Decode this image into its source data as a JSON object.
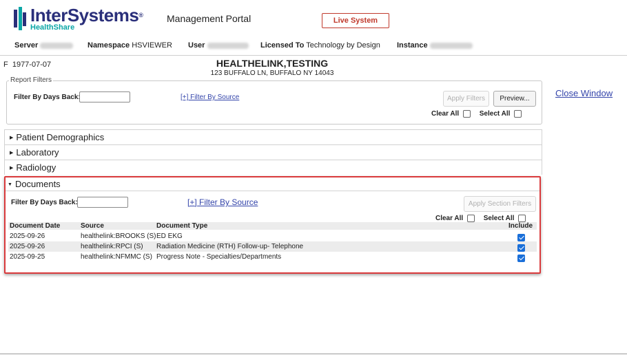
{
  "header": {
    "logo_text": "InterSystems",
    "logo_reg": "®",
    "logo_sub": "HealthShare",
    "portal_title": "Management Portal",
    "live_badge": "Live System"
  },
  "info_bar": {
    "server_label": "Server",
    "namespace_label": "Namespace",
    "namespace_value": "HSVIEWER",
    "user_label": "User",
    "licensed_label": "Licensed To",
    "licensed_value": "Technology by Design",
    "instance_label": "Instance"
  },
  "patient": {
    "sex_dob": "F  1977-07-07",
    "name": "HEALTHELINK,TESTING",
    "address": "123 BUFFALO LN, BUFFALO NY 14043"
  },
  "report_filters": {
    "legend": "Report Filters",
    "days_back_label": "Filter By Days Back:",
    "days_back_value": "",
    "filter_by_source": "[+] Filter By Source",
    "apply_filters": "Apply Filters",
    "preview": "Preview...",
    "clear_all": "Clear All",
    "select_all": "Select All"
  },
  "close_window": "Close Window",
  "sections": [
    {
      "label": "Patient Demographics",
      "expanded": false
    },
    {
      "label": "Laboratory",
      "expanded": false
    },
    {
      "label": "Radiology",
      "expanded": false
    },
    {
      "label": "Documents",
      "expanded": true
    }
  ],
  "documents": {
    "days_back_label": "Filter By Days Back:",
    "days_back_value": "",
    "filter_by_source": "[+] Filter By Source",
    "apply_section_filters": "Apply Section Filters",
    "clear_all": "Clear All",
    "select_all": "Select All",
    "columns": {
      "date": "Document Date",
      "source": "Source",
      "type": "Document Type",
      "include": "Include"
    },
    "rows": [
      {
        "date": "2025-09-26",
        "source": "healthelink:BROOKS (S)",
        "type": "ED EKG",
        "include": true
      },
      {
        "date": "2025-09-26",
        "source": "healthelink:RPCI (S)",
        "type": "Radiation Medicine (RTH) Follow-up- Telephone",
        "include": true
      },
      {
        "date": "2025-09-25",
        "source": "healthelink:NFMMC (S)",
        "type": "Progress Note - Specialties/Departments",
        "include": true
      }
    ]
  },
  "colors": {
    "brand": "#2a2f7a",
    "brand_accent": "#0aa6a6",
    "live_badge": "#c0392b",
    "highlight_border": "#d9393b",
    "link": "#3344aa",
    "checkbox_on": "#1a6fd9"
  }
}
